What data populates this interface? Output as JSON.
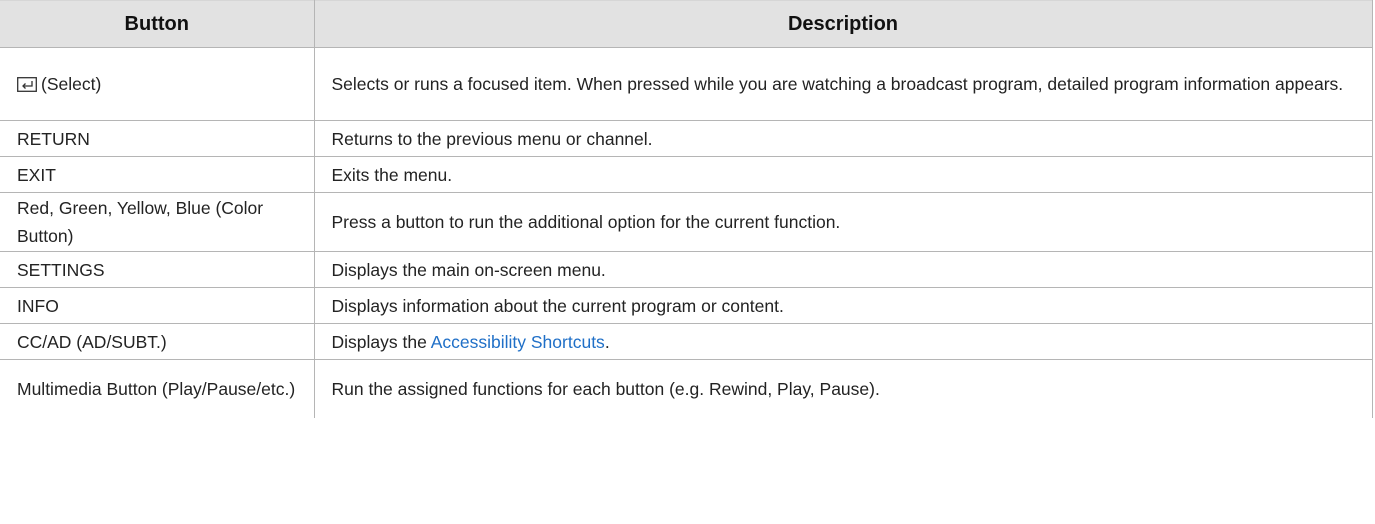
{
  "header": {
    "button": "Button",
    "description": "Description"
  },
  "rows": [
    {
      "button": "(Select)",
      "icon": "enter-icon",
      "description": "Selects or runs a focused item. When pressed while you are watching a broadcast program, detailed program information appears."
    },
    {
      "button": "RETURN",
      "description": "Returns to the previous menu or channel."
    },
    {
      "button": "EXIT",
      "description": "Exits the menu."
    },
    {
      "button": "Red, Green, Yellow, Blue (Color Button)",
      "description": "Press a button to run the additional option for the current function."
    },
    {
      "button": "SETTINGS",
      "description": "Displays the main on-screen menu."
    },
    {
      "button": "INFO",
      "description": "Displays information about the current program or content."
    },
    {
      "button": "CC/AD (AD/SUBT.)",
      "description_prefix": "Displays the ",
      "description_link": "Accessibility Shortcuts",
      "description_suffix": "."
    },
    {
      "button": "Multimedia Button (Play/Pause/etc.)",
      "description": "Run the assigned functions for each button (e.g. Rewind, Play, Pause)."
    }
  ],
  "colors": {
    "header_bg": "#e2e2e2",
    "border": "#b5b5b5",
    "link": "#1f6fc7"
  }
}
